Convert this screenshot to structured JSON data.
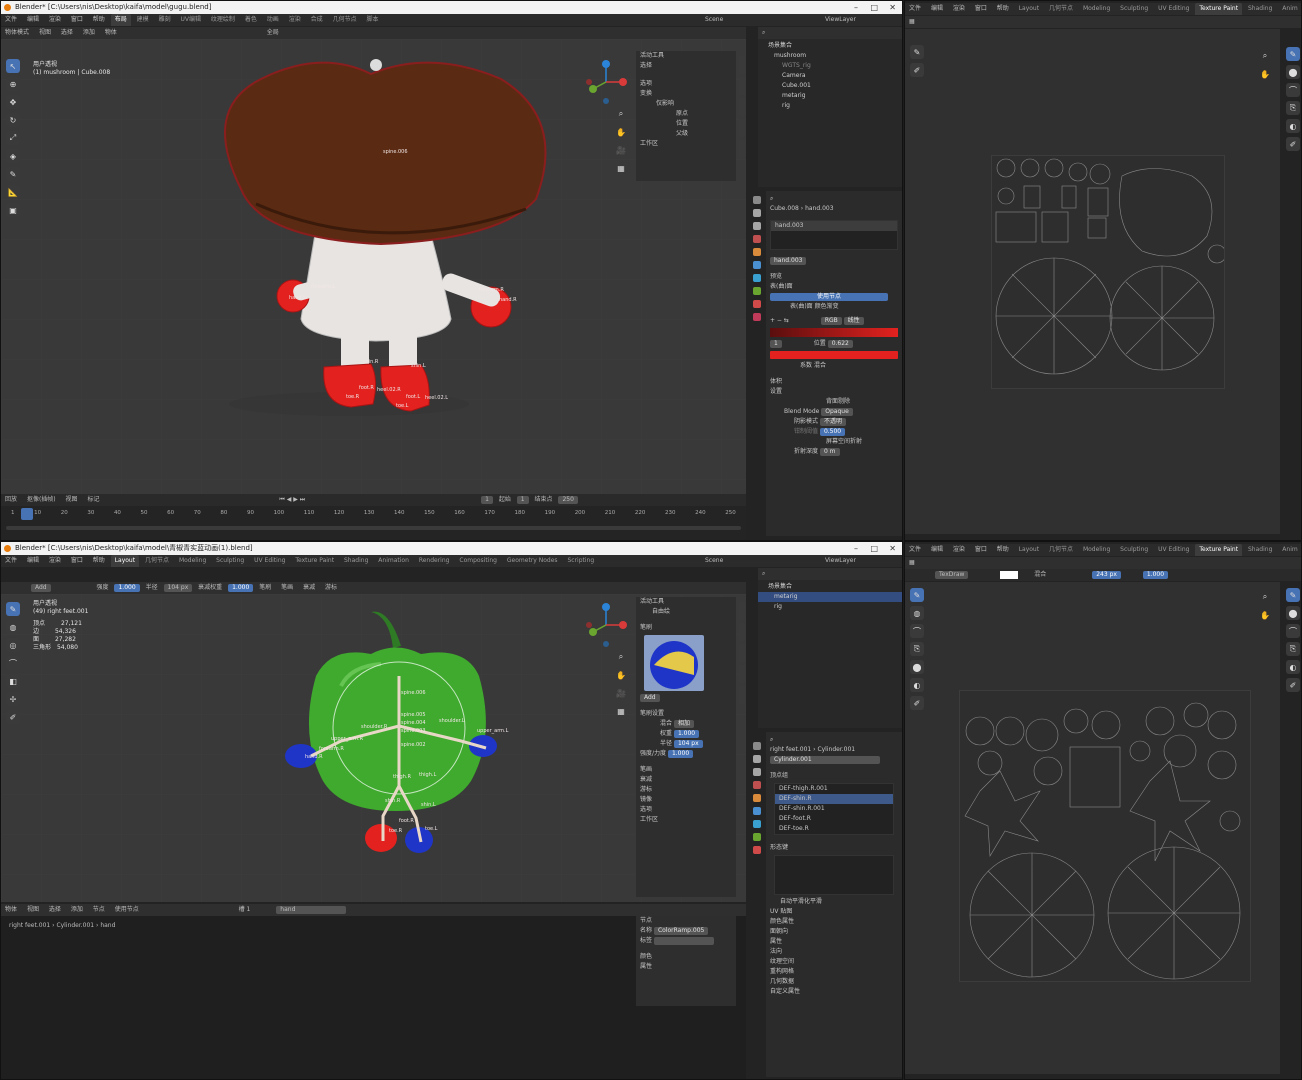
{
  "top_window": {
    "title": "Blender* [C:\\Users\\nis\\Desktop\\kaifa\\model\\gugu.blend]",
    "menu": [
      "文件",
      "编辑",
      "渲染",
      "窗口",
      "帮助"
    ],
    "workspace_tabs": [
      "布局",
      "建模",
      "雕刻",
      "UV编辑",
      "纹理绘制",
      "着色",
      "动画",
      "渲染",
      "合成",
      "几何节点",
      "脚本"
    ],
    "active_tab_index": 0,
    "scene_label": "Scene",
    "viewlayer_label": "ViewLayer",
    "header": {
      "mode": "物体模式",
      "view": "视图",
      "select": "选择",
      "add": "添加",
      "object": "物体",
      "transform": "全局"
    },
    "viewport_overlay": [
      "用户透视",
      "(1) mushroom | Cube.008"
    ],
    "bones": [
      "spine.006",
      "forearm.R",
      "hand.R",
      "forearm.L",
      "hand.L",
      "shin.R",
      "shin.L",
      "foot.R",
      "heel.02.R",
      "foot.L",
      "heel.02.L",
      "toe.R",
      "toe.L"
    ],
    "tool_panel": {
      "title": "活动工具",
      "sub": "选择",
      "section_options": "选项",
      "transform": "变换",
      "affect_only": "仅影响",
      "origins": "原点",
      "locations": "位置",
      "parents": "父级",
      "workspace": "工作区"
    },
    "outliner": {
      "title": "场景集合",
      "items": [
        "mushroom",
        "WGTS_rig",
        "Camera",
        "Cube.001",
        "metarig",
        "rig"
      ]
    },
    "properties": {
      "breadcrumb_object": "Cube.008",
      "breadcrumb_material": "hand.003",
      "material_slot": "hand.003",
      "material_name": "hand.003",
      "section_preview": "预览",
      "section_surface": "表(曲)面",
      "use_nodes": "使用节点",
      "surface_label": "表(曲)面",
      "surface_value": "颜色渐变",
      "ramp_mode": "RGB",
      "ramp_interp": "线性",
      "ramp_index": "1",
      "ramp_pos_label": "位置",
      "ramp_pos_value": "0.622",
      "factor_label": "系数",
      "mix_label": "混合",
      "section_volume": "体积",
      "section_settings": "设置",
      "backface": "背面剔除",
      "blend_mode_label": "Blend Mode",
      "blend_mode_value": "Opaque",
      "shadow_label": "阴影模式",
      "shadow_value": "不透明",
      "clip_label": "钳制阈值",
      "clip_value": "0.500",
      "ss_refraction": "屏幕空间折射",
      "refraction_depth_label": "折射深度",
      "refraction_depth_value": "0 m"
    },
    "timeline": {
      "menu": [
        "回放",
        "抠像(插帧)",
        "视图",
        "标记"
      ],
      "current_frame": "1",
      "start_label": "起始",
      "start_value": "1",
      "end_label": "结束点",
      "end_value": "250",
      "ticks": [
        "1",
        "10",
        "20",
        "30",
        "40",
        "50",
        "60",
        "70",
        "80",
        "90",
        "100",
        "110",
        "120",
        "130",
        "140",
        "150",
        "160",
        "170",
        "180",
        "190",
        "200",
        "210",
        "220",
        "230",
        "240",
        "250"
      ]
    }
  },
  "top_uv_window": {
    "menu": [
      "文件",
      "编辑",
      "渲染",
      "窗口",
      "帮助"
    ],
    "workspace_tabs": [
      "Layout",
      "几何节点",
      "Modeling",
      "Sculpting",
      "UV Editing",
      "Texture Paint",
      "Shading",
      "Anim"
    ],
    "active_tab_index": 5
  },
  "bottom_window": {
    "title": "Blender* [C:\\Users\\nis\\Desktop\\kaifa\\model\\青椒青实蓝动画(1).blend]",
    "menu": [
      "文件",
      "编辑",
      "渲染",
      "窗口",
      "帮助"
    ],
    "workspace_tabs": [
      "Layout",
      "几何节点",
      "Modeling",
      "Sculpting",
      "UV Editing",
      "Texture Paint",
      "Shading",
      "Animation",
      "Rendering",
      "Compositing",
      "Geometry Nodes",
      "Scripting"
    ],
    "active_tab_index": 0,
    "scene_label": "Scene",
    "viewlayer_label": "ViewLayer",
    "brush_header": {
      "blend": "Add",
      "strength_label": "强度",
      "strength_value": "1.000",
      "radius_label": "半径",
      "radius_value": "104 px",
      "falloff_label": "衰减权重",
      "falloff_value": "1.000",
      "brush": "笔刷",
      "stroke": "笔画",
      "falloff": "衰减",
      "cursor": "游标"
    },
    "viewport_overlay": [
      "用户透视",
      "(49) right feet.001"
    ],
    "stats": [
      {
        "label": "顶点",
        "value": "27,121"
      },
      {
        "label": "边",
        "value": "54,326"
      },
      {
        "label": "面",
        "value": "27,282"
      },
      {
        "label": "三角形",
        "value": "54,080"
      }
    ],
    "bones": [
      "spine.006",
      "spine.005",
      "spine.004",
      "spine.003",
      "spine.002",
      "shoulder.R",
      "shoulder.L",
      "upper_arm.R",
      "upper_arm.L",
      "forearm.R",
      "hand.R",
      "thigh.R",
      "thigh.L",
      "shin.R",
      "shin.L",
      "foot.R",
      "toe.R",
      "toe.L"
    ],
    "tool_panel": {
      "title": "活动工具",
      "draw": "自由绘",
      "brushes": "笔刷",
      "brush_name": "Add",
      "brush_settings": "笔刷设置",
      "blend_label": "混合",
      "blend_value": "相加",
      "weight_label": "权重",
      "weight_value": "1.000",
      "radius_label": "半径",
      "radius_value": "104 px",
      "strength_label": "强度/力度",
      "strength_value": "1.000",
      "stroke": "笔画",
      "falloff": "衰减",
      "cursor": "游标",
      "symmetry": "镜像",
      "options": "选项",
      "workspace": "工作区"
    },
    "outliner": {
      "title": "场景集合",
      "items": [
        "metarig",
        "rig"
      ]
    },
    "properties": {
      "breadcrumb_object": "right feet.001",
      "breadcrumb_mesh": "Cylinder.001",
      "mesh_name": "Cylinder.001",
      "section_vgroups": "顶点组",
      "vgroups": [
        "DEF-thigh.R.001",
        "DEF-shin.R",
        "DEF-shin.R.001",
        "DEF-foot.R",
        "DEF-toe.R"
      ],
      "section_shapekeys": "形态键",
      "section_uvmaps": "UV 贴图",
      "section_vcolors": "颜色属性",
      "section_faces": "面朝向",
      "section_attributes": "属性",
      "section_normals": "法向",
      "section_texspace": "纹理空间",
      "section_remesh": "重构网格",
      "section_geodata": "几何数据",
      "section_custom": "自定义属性",
      "auto_smooth": "自动平滑化平滑"
    },
    "shader_header": {
      "object": "物体",
      "view": "视图",
      "select": "选择",
      "add": "添加",
      "node": "节点",
      "use_nodes": "使用节点",
      "slot": "槽 1",
      "material": "hand"
    },
    "shader_breadcrumb": [
      "right feet.001",
      "Cylinder.001",
      "hand"
    ],
    "node_panel": {
      "title": "节点",
      "name_label": "名称",
      "name_value": "ColorRamp.005",
      "label_label": "标签",
      "color": "颜色",
      "properties": "属性"
    }
  },
  "bottom_uv_window": {
    "menu": [
      "文件",
      "编辑",
      "渲染",
      "窗口",
      "帮助"
    ],
    "workspace_tabs": [
      "Layout",
      "几何节点",
      "Modeling",
      "Sculpting",
      "UV Editing",
      "Texture Paint",
      "Shading",
      "Anim"
    ],
    "active_tab_index": 5,
    "brush_name": "TexDraw",
    "blend": "混合",
    "radius_value": "243 px",
    "strength_value": "1.000"
  },
  "colors": {
    "accent": "#4772b3",
    "mushroom_cap": "#5a2a12",
    "glove_red": "#e3221f",
    "pepper_green": "#3faa2e"
  }
}
